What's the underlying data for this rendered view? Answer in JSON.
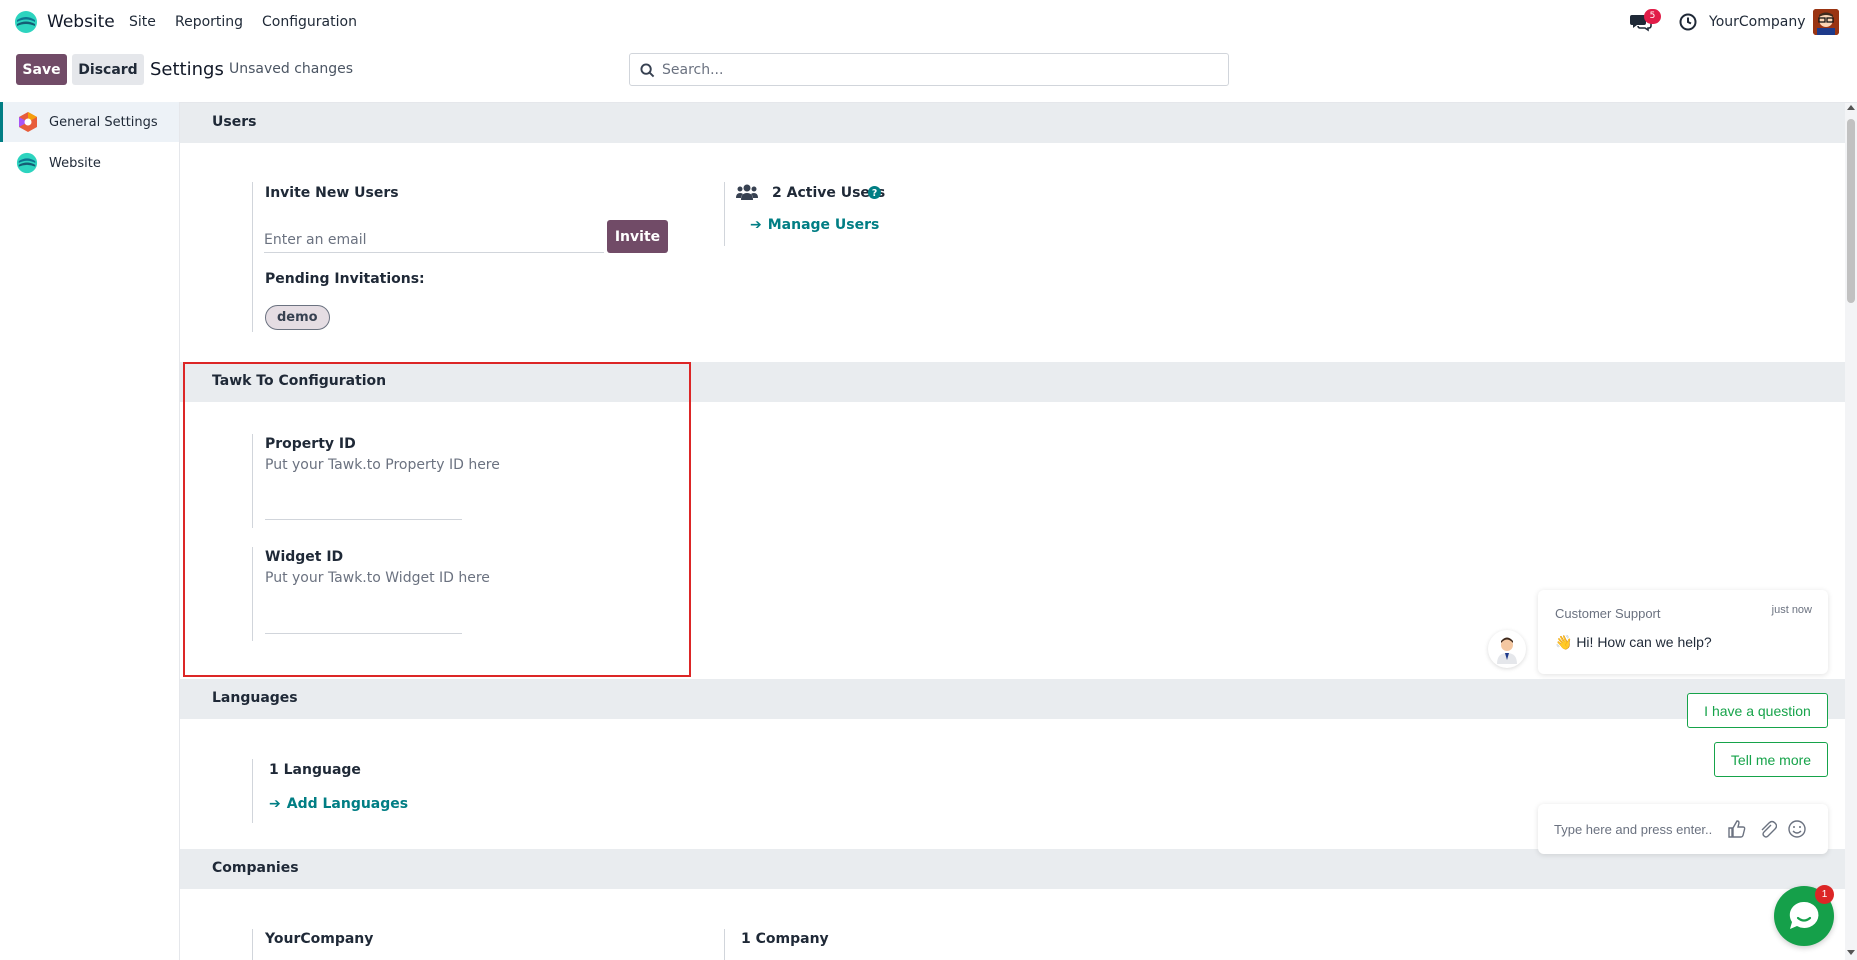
{
  "navbar": {
    "app_name": "Website",
    "menus": [
      "Site",
      "Reporting",
      "Configuration"
    ],
    "chat_badge": "5",
    "company": "YourCompany"
  },
  "control_panel": {
    "save_label": "Save",
    "discard_label": "Discard",
    "title": "Settings",
    "status": "Unsaved changes",
    "search_placeholder": "Search..."
  },
  "sidebar": {
    "items": [
      {
        "label": "General Settings",
        "active": true
      },
      {
        "label": "Website",
        "active": false
      }
    ]
  },
  "users": {
    "title": "Users",
    "invite_label": "Invite New Users",
    "email_placeholder": "Enter an email",
    "invite_button": "Invite",
    "pending_label": "Pending Invitations:",
    "pending_tag": "demo",
    "active_users": "2 Active Users",
    "manage_link": "Manage Users"
  },
  "tawk": {
    "title": "Tawk To Configuration",
    "property_label": "Property ID",
    "property_desc": "Put your Tawk.to Property ID here",
    "widget_label": "Widget ID",
    "widget_desc": "Put your Tawk.to Widget ID here"
  },
  "languages": {
    "title": "Languages",
    "count": "1 Language",
    "add_link": "Add Languages"
  },
  "companies": {
    "title": "Companies",
    "company_name": "YourCompany",
    "count": "1 Company"
  },
  "chat_widget": {
    "from": "Customer Support",
    "time": "just now",
    "message": "👋 Hi! How can we help?",
    "quick_replies": [
      "I have a question",
      "Tell me more"
    ],
    "input_placeholder": "Type here and press enter..",
    "launcher_badge": "1",
    "accent": "#15a04a"
  },
  "colors": {
    "primary": "#714b67",
    "link": "#017e84",
    "highlight_box": "#dc2626"
  }
}
